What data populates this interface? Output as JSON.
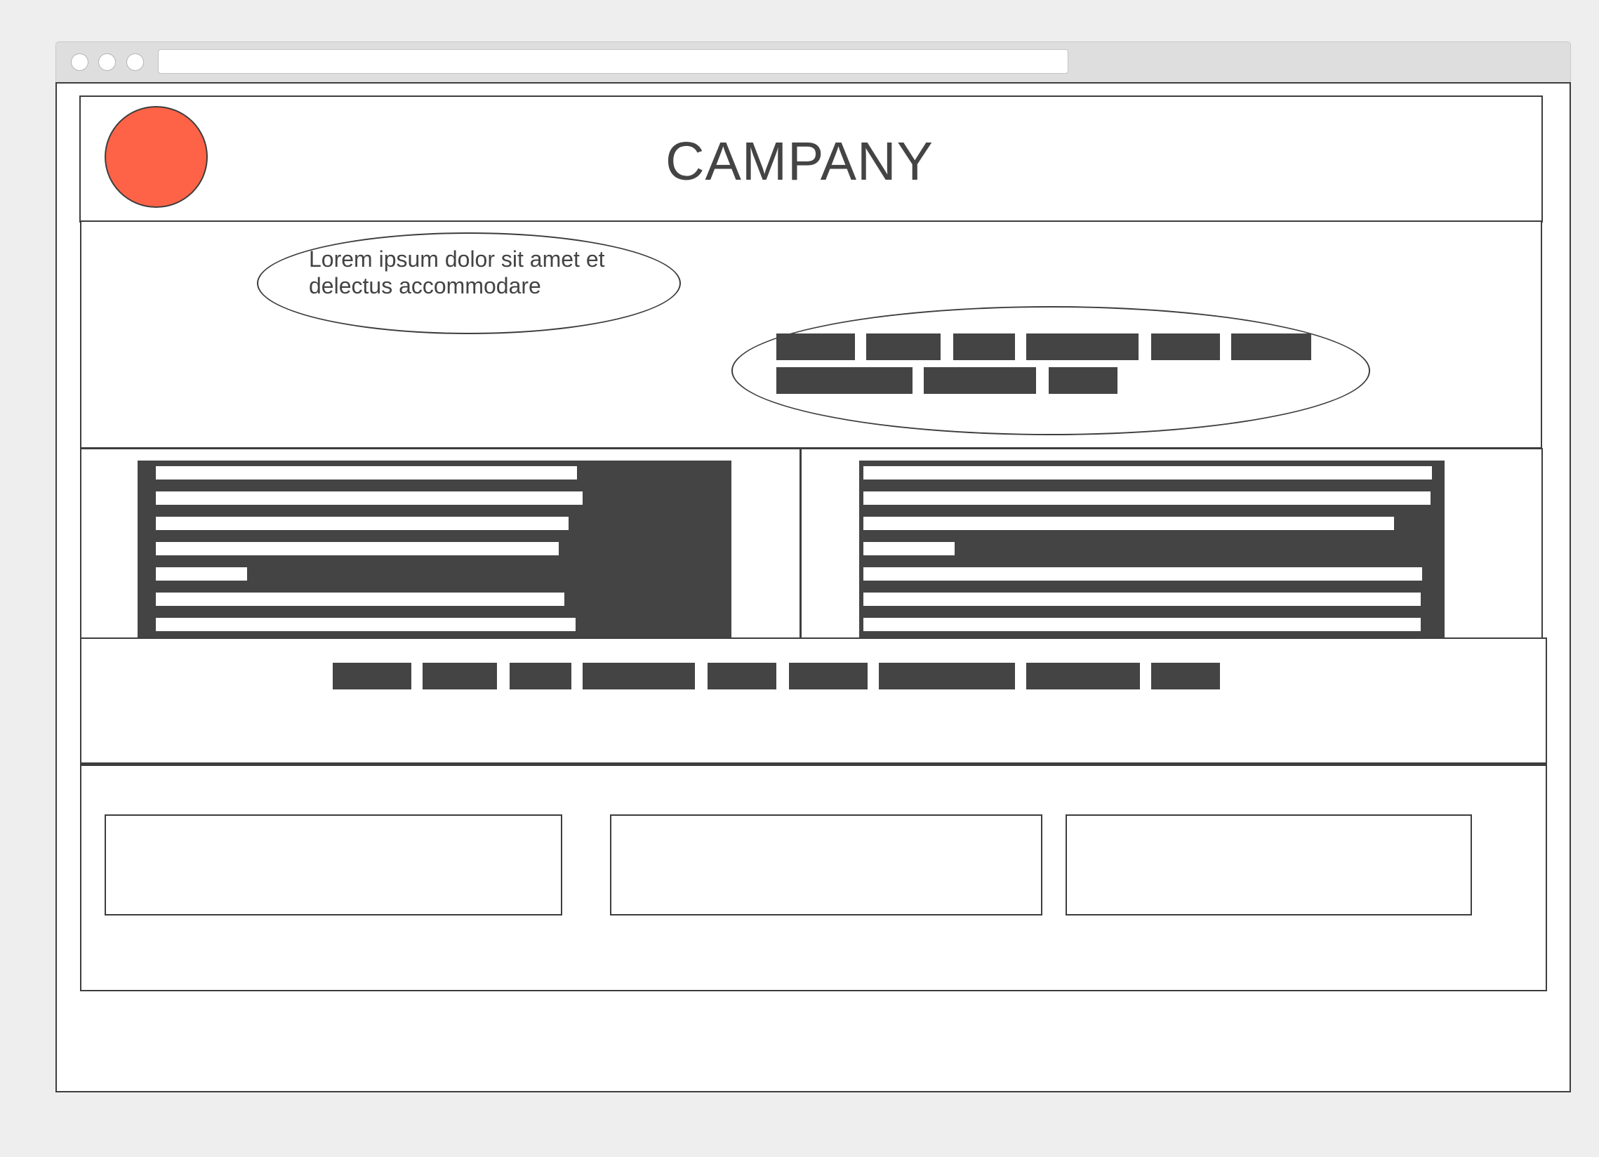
{
  "header": {
    "title": "CAMPANY"
  },
  "hero": {
    "tagline_line1": "Lorem ipsum dolor sit amet et",
    "tagline_line2": "delectus accommodare"
  },
  "colors": {
    "logo": "#ff6347",
    "ink": "#444444",
    "chrome": "#dedede",
    "background": "#eeeeee"
  },
  "icons": {
    "logo": "logo-circle-icon"
  }
}
